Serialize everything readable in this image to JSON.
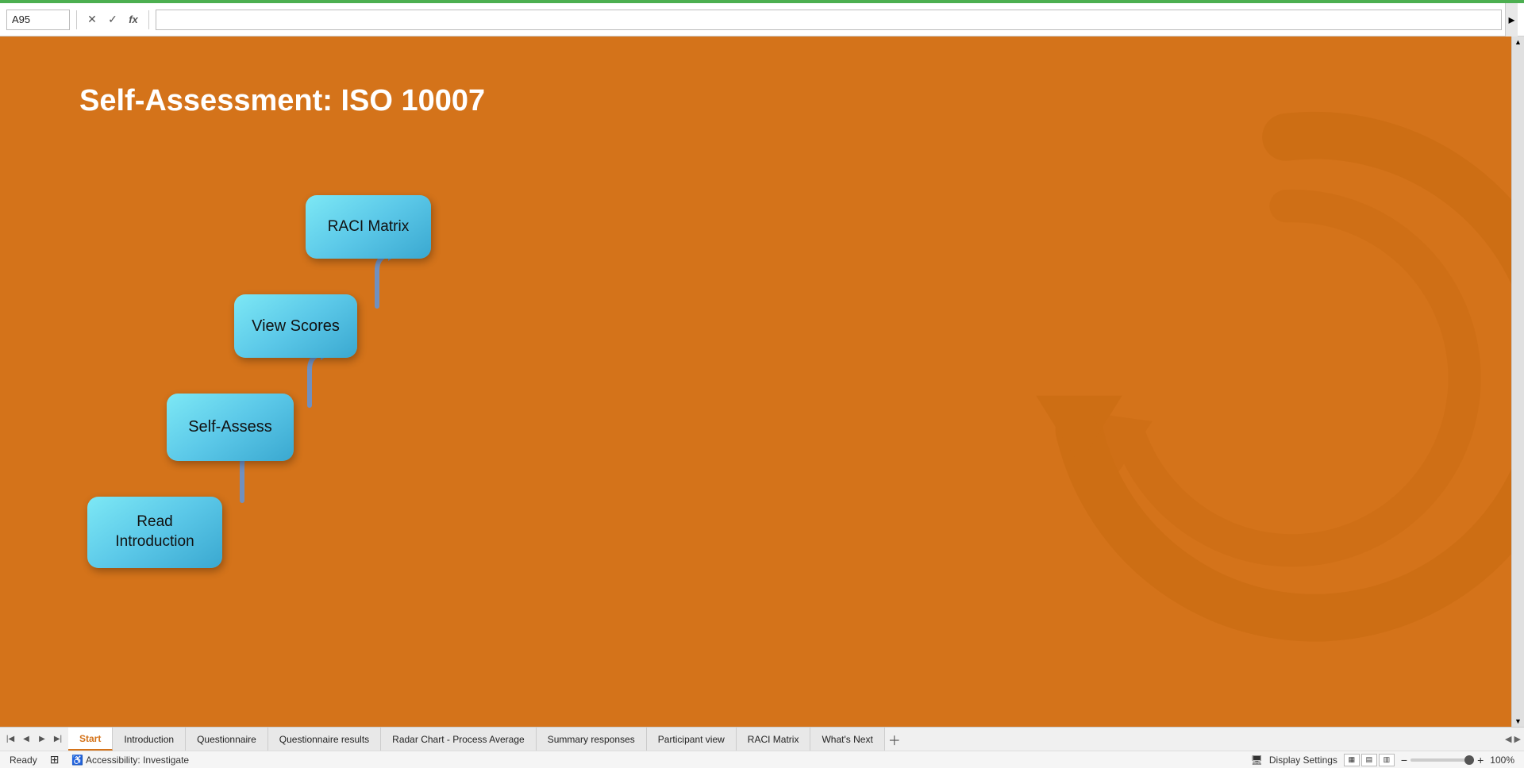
{
  "excel": {
    "cell_ref": "A95",
    "formula": "",
    "topbar_icons": [
      "✕",
      "✓",
      "fx"
    ]
  },
  "page": {
    "title": "Self-Assessment: ISO 10007",
    "background_color": "#d4731a"
  },
  "buttons": {
    "read_intro": "Read Introduction",
    "self_assess": "Self-Assess",
    "view_scores": "View Scores",
    "raci_matrix": "RACI Matrix"
  },
  "tabs": [
    {
      "label": "Start",
      "active": true
    },
    {
      "label": "Introduction",
      "active": false
    },
    {
      "label": "Questionnaire",
      "active": false
    },
    {
      "label": "Questionnaire results",
      "active": false
    },
    {
      "label": "Radar Chart - Process Average",
      "active": false
    },
    {
      "label": "Summary responses",
      "active": false
    },
    {
      "label": "Participant view",
      "active": false
    },
    {
      "label": "RACI Matrix",
      "active": false
    },
    {
      "label": "What's Next",
      "active": false
    }
  ],
  "status": {
    "ready": "Ready",
    "accessibility": "Accessibility: Investigate",
    "display_settings": "Display Settings",
    "zoom": "100%"
  }
}
